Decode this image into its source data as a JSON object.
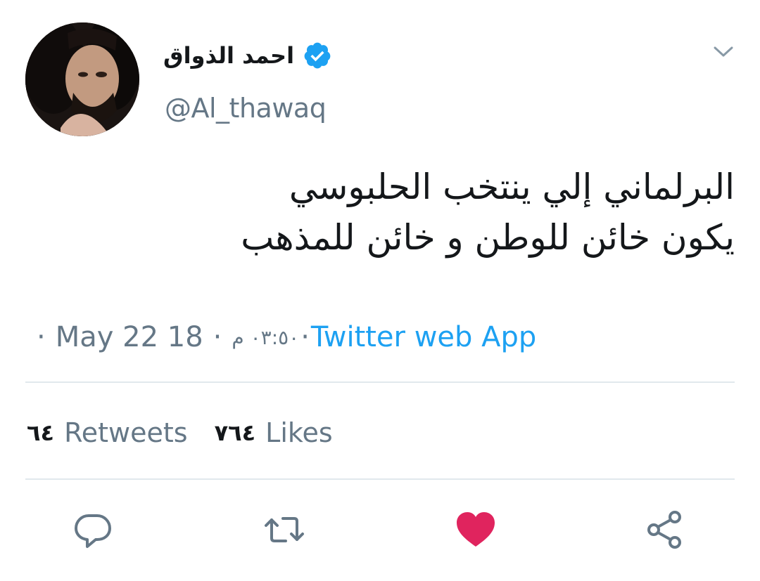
{
  "tweet": {
    "author": {
      "display_name": "احمد الذواق",
      "handle": "@Al_thawaq",
      "verified_icon": "verified-badge-icon"
    },
    "text_lines": [
      "البرلماني إلي ينتخب الحلبوسي",
      "يكون خائن للوطن و خائن للمذهب"
    ],
    "meta": {
      "date": "May 22 18",
      "separator": "·",
      "time": "٠٣:٥٠ م",
      "source": "Twitter web App"
    },
    "stats": {
      "retweets_count": "٦٤",
      "retweets_label": "Retweets",
      "likes_count": "٧٦٤",
      "likes_label": "Likes"
    },
    "actions": {
      "reply": "reply-icon",
      "retweet": "retweet-icon",
      "like": "heart-icon",
      "share": "share-icon"
    }
  },
  "colors": {
    "text": "#14171a",
    "secondary": "#657786",
    "link": "#1da1f2",
    "like": "#e0245e",
    "divider": "#e1e8ed"
  }
}
